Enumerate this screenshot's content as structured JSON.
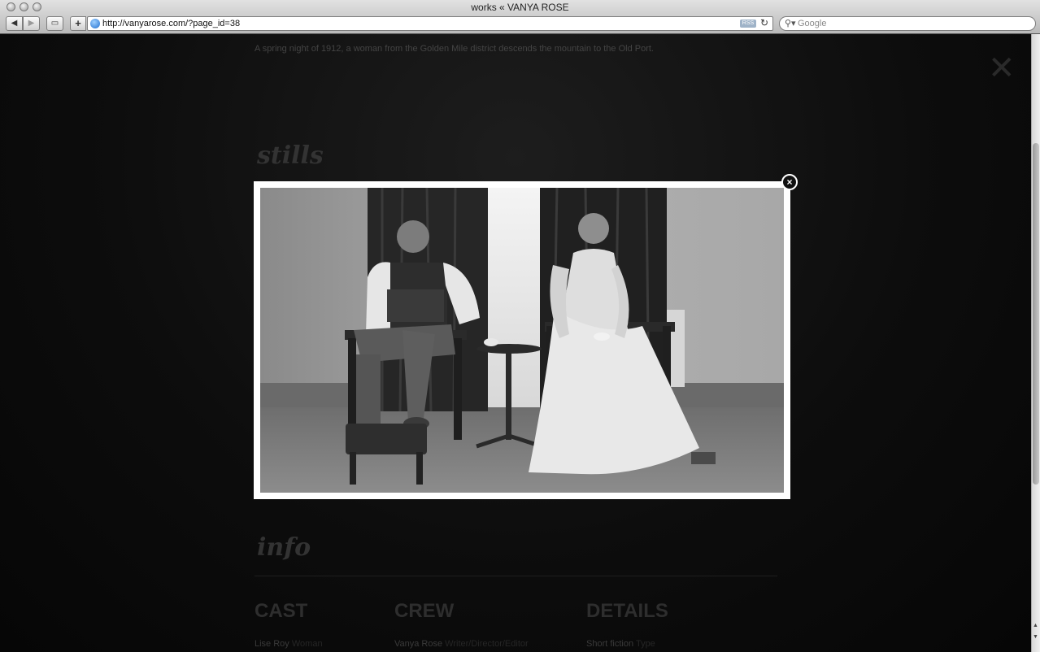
{
  "window": {
    "title": "works « VANYA ROSE"
  },
  "toolbar": {
    "back_glyph": "◀",
    "forward_glyph": "▶",
    "bookmarks_glyph": "▭",
    "add_glyph": "+",
    "url": "http://vanyarose.com/?page_id=38",
    "rss_label": "RSS",
    "reload_glyph": "↻",
    "search_placeholder": "Google",
    "search_glyph": "⚲▾"
  },
  "page": {
    "intro": "A spring night of 1912, a woman from the Golden Mile district descends the mountain to the Old Port.",
    "bg_close_glyph": "✕",
    "stills_heading": "stills",
    "info_heading": "info",
    "columns": [
      {
        "title": "CAST",
        "name": "Lise Roy",
        "role": "Woman"
      },
      {
        "title": "CREW",
        "name": "Vanya Rose",
        "role": "Writer/Director/Editor"
      },
      {
        "title": "DETAILS",
        "name": "Short fiction",
        "role": "Type"
      }
    ]
  },
  "lightbox": {
    "close_glyph": "×"
  },
  "scrollbar": {
    "up_glyph": "▲",
    "down_glyph": "▼"
  },
  "colors": {
    "page_bg": "#0a0a0a",
    "lightbox_frame": "#ffffff",
    "muted_text": "#444444"
  }
}
